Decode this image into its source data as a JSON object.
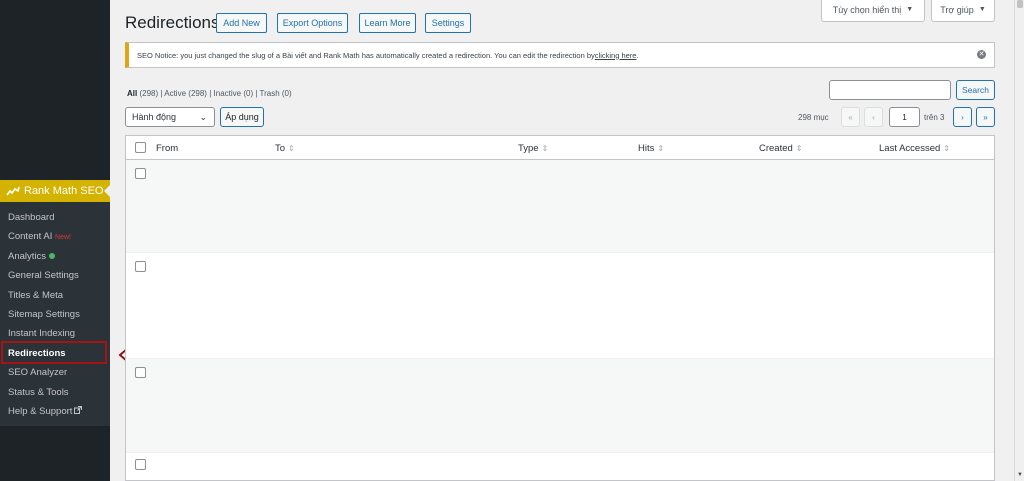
{
  "sidebar": {
    "plugin_name": "Rank Math SEO",
    "items": [
      {
        "label": "Dashboard"
      },
      {
        "label": "Content AI",
        "badge": "New!"
      },
      {
        "label": "Analytics"
      },
      {
        "label": "General Settings"
      },
      {
        "label": "Titles & Meta"
      },
      {
        "label": "Sitemap Settings"
      },
      {
        "label": "Instant Indexing"
      },
      {
        "label": "Redirections"
      },
      {
        "label": "SEO Analyzer"
      },
      {
        "label": "Status & Tools"
      },
      {
        "label": "Help & Support"
      }
    ]
  },
  "header": {
    "title": "Redirections",
    "buttons": {
      "add_new": "Add New",
      "export_options": "Export Options",
      "learn_more": "Learn More",
      "settings": "Settings"
    },
    "screen_options": "Tùy chọn hiển thị",
    "help": "Trợ giúp"
  },
  "notice": {
    "text": "SEO Notice: you just changed the slug of a Bài viết and Rank Math has automatically created a redirection. You can edit the redirection by ",
    "link": "clicking here",
    "end": "."
  },
  "filters": {
    "all": "All",
    "all_count": "(298)",
    "active": "Active",
    "active_count": "(298)",
    "inactive": "Inactive",
    "inactive_count": "(0)",
    "trash": "Trash",
    "trash_count": "(0)",
    "sep": "|"
  },
  "search": {
    "button": "Search",
    "value": ""
  },
  "bulk": {
    "selected": "Hành động",
    "apply": "Áp dụng"
  },
  "pagination": {
    "items": "298 mục",
    "first": "«",
    "prev": "‹",
    "current": "1",
    "of_text": "trên 3",
    "next": "›",
    "last": "»"
  },
  "table": {
    "columns": [
      "From",
      "To",
      "Type",
      "Hits",
      "Created",
      "Last Accessed"
    ],
    "sort_indicator": "⇕"
  },
  "icons": {
    "close": "close-icon",
    "external": "external-link-icon",
    "arrow": "left-arrow-icon"
  },
  "colors": {
    "accent": "#2271b1",
    "rank_math": "#d4b300",
    "notice_border": "#dba617",
    "highlight": "#a31515"
  }
}
